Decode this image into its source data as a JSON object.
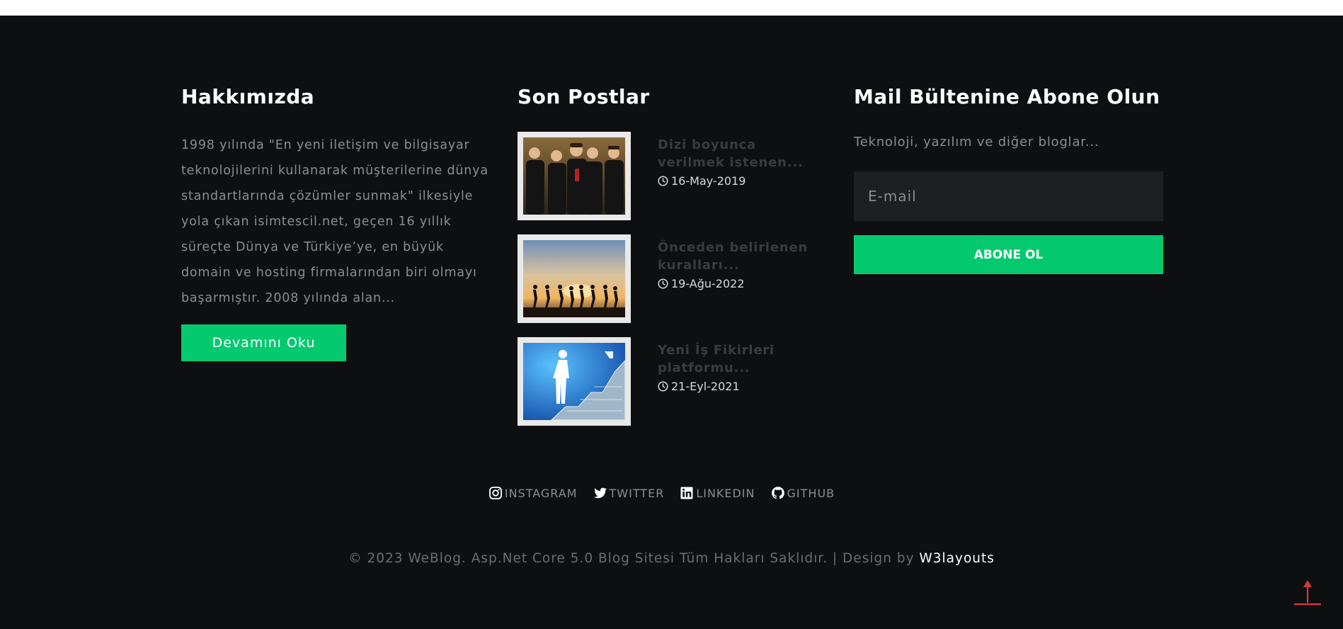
{
  "about": {
    "heading": "Hakkımızda",
    "text": "1998 yılında \"En yeni iletişim ve bilgisayar teknolojilerini kullanarak müşterilerine dünya standartlarında çözümler sunmak\" ilkesiyle yola çıkan isimtescil.net, geçen 16 yıllık süreçte Dünya ve Türkiye’ye, en büyük domain ve hosting firmalarından biri olmayı başarmıştır. 2008 yılında alan...",
    "button_label": "Devamını Oku"
  },
  "posts": {
    "heading": "Son Postlar",
    "items": [
      {
        "title": "Dizi boyunca verilmek istenen...",
        "date": "16-May-2019",
        "image_icon": "group-photo"
      },
      {
        "title": "Önceden belirlenen kuralları...",
        "date": "19-Ağu-2022",
        "image_icon": "runners-sunset"
      },
      {
        "title": "Yeni İş Fikirleri platformu...",
        "date": "21-Eyl-2021",
        "image_icon": "business-stairs"
      }
    ]
  },
  "newsletter": {
    "heading": "Mail Bültenine Abone Olun",
    "text": "Teknoloji, yazılım ve diğer bloglar...",
    "email_placeholder": "E-mail",
    "button_label": "ABONE OL"
  },
  "social": [
    {
      "label": "INSTAGRAM",
      "icon": "instagram-icon"
    },
    {
      "label": "TWITTER",
      "icon": "twitter-icon"
    },
    {
      "label": "LINKEDIN",
      "icon": "linkedin-icon"
    },
    {
      "label": "GITHUB",
      "icon": "github-icon"
    }
  ],
  "footer": {
    "copyright": "© 2023 WeBlog. Asp.Net Core 5.0 Blog Sitesi Tüm Hakları Saklıdır. | Design by ",
    "credit": "W3layouts"
  },
  "colors": {
    "background": "#0e0f11",
    "accent": "#04c96f",
    "input_bg": "#1e1f23",
    "back_to_top": "#d23c3c"
  },
  "icons": {
    "clock": "clock-icon",
    "back_to_top": "arrow-up-icon"
  }
}
